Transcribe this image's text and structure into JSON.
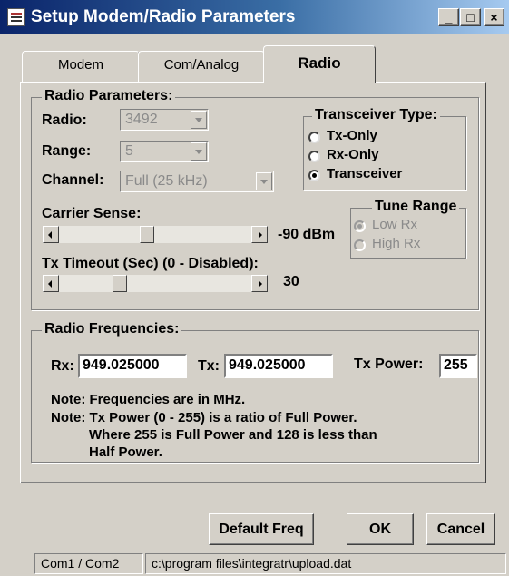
{
  "window": {
    "title": "Setup Modem/Radio Parameters",
    "controls": {
      "minimize": "_",
      "maximize": "□",
      "close": "×"
    }
  },
  "tabs": [
    {
      "label": "Modem",
      "active": false
    },
    {
      "label": "Com/Analog",
      "active": false
    },
    {
      "label": "Radio",
      "active": true
    }
  ],
  "radio_params": {
    "group_title": "Radio Parameters:",
    "radio_label": "Radio:",
    "radio_value": "3492",
    "range_label": "Range:",
    "range_value": "5",
    "channel_label": "Channel:",
    "channel_value": "Full (25 kHz)",
    "carrier_sense_label": "Carrier Sense:",
    "carrier_sense_value": "-90 dBm",
    "carrier_sense_position": 0.45,
    "tx_timeout_label": "Tx Timeout (Sec) (0 - Disabled):",
    "tx_timeout_value": "30",
    "tx_timeout_position": 0.3
  },
  "transceiver_type": {
    "title": "Transceiver Type:",
    "options": [
      "Tx-Only",
      "Rx-Only",
      "Transceiver"
    ],
    "selected": "Transceiver"
  },
  "tune_range": {
    "title": "Tune Range",
    "options": [
      "Low Rx",
      "High Rx"
    ],
    "selected": "Low Rx",
    "enabled": false
  },
  "radio_frequencies": {
    "group_title": "Radio Frequencies:",
    "rx_label": "Rx:",
    "rx_value": "949.025000",
    "tx_label": "Tx:",
    "tx_value": "949.025000",
    "tx_power_label": "Tx Power:",
    "tx_power_value": "255",
    "note1": "Note: Frequencies are in MHz.",
    "note2": "Note: Tx Power (0 - 255) is a ratio of Full Power.",
    "note3": "Where 255 is Full Power and 128 is less than",
    "note4": "Half Power."
  },
  "buttons": {
    "default_freq": "Default Freq",
    "ok": "OK",
    "cancel": "Cancel"
  },
  "statusbar": {
    "ports": "Com1 / Com2",
    "path": "c:\\program files\\integratr\\upload.dat"
  },
  "colors": {
    "titlebar_start": "#0a246a",
    "titlebar_end": "#a6caf0",
    "face": "#d4d0c8"
  }
}
